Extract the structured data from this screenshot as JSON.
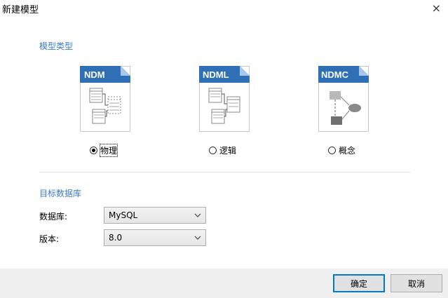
{
  "window": {
    "title": "新建模型",
    "close_symbol": "×"
  },
  "model_type": {
    "heading": "模型类型",
    "options": [
      {
        "badge": "NDM",
        "label": "物理",
        "selected": true
      },
      {
        "badge": "NDML",
        "label": "逻辑",
        "selected": false
      },
      {
        "badge": "NDMC",
        "label": "概念",
        "selected": false
      }
    ]
  },
  "target_db": {
    "heading": "目标数据库",
    "database_label": "数据库:",
    "database_value": "MySQL",
    "version_label": "版本:",
    "version_value": "8.0"
  },
  "buttons": {
    "ok": "确定",
    "cancel": "取消"
  },
  "colors": {
    "accent": "#3b7cc6",
    "badge": "#2e6fb5"
  }
}
